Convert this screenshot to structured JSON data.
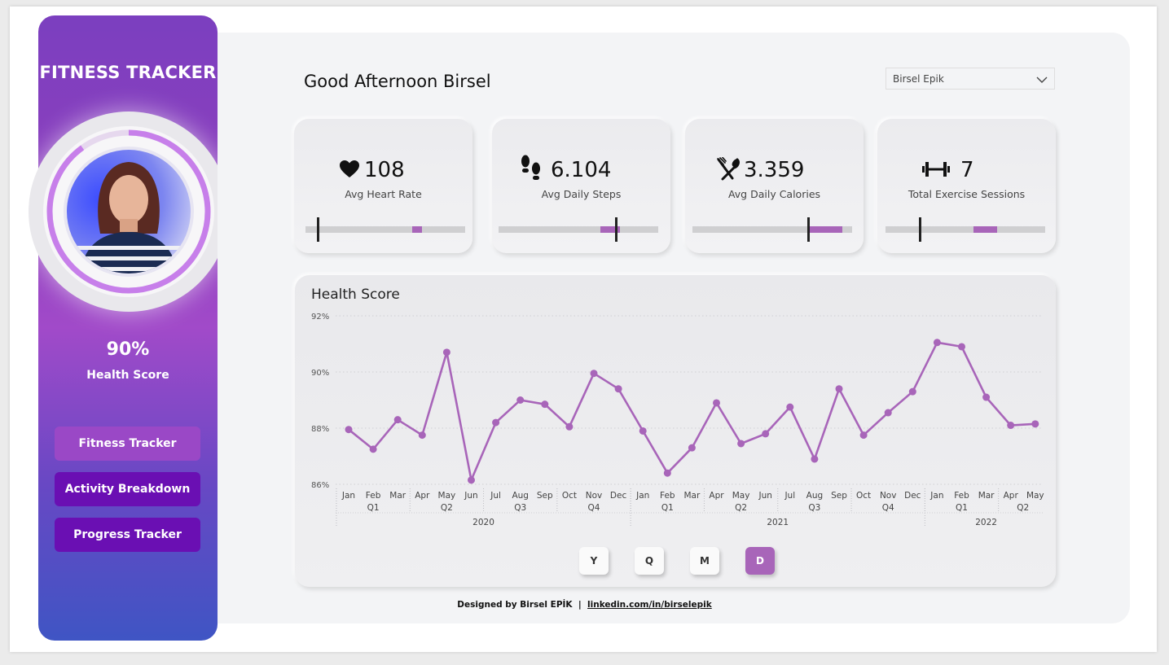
{
  "sidebar": {
    "title": "FITNESS TRACKER",
    "health_score_value": "90%",
    "health_score_fraction": 0.9,
    "health_score_label": "Health Score",
    "nav": [
      {
        "label": "Fitness Tracker",
        "active": true
      },
      {
        "label": "Activity Breakdown",
        "active": false
      },
      {
        "label": "Progress Tracker",
        "active": false
      }
    ]
  },
  "header": {
    "greeting": "Good Afternoon Birsel",
    "user_select": "Birsel Epik"
  },
  "kpis": [
    {
      "icon": "heart-icon",
      "value": "108",
      "label": "Avg Heart Rate",
      "fill_start": 0.67,
      "fill_end": 0.73,
      "marker": 0.07
    },
    {
      "icon": "footsteps-icon",
      "value": "6.104",
      "label": "Avg Daily Steps",
      "fill_start": 0.64,
      "fill_end": 0.76,
      "marker": 0.73
    },
    {
      "icon": "fork-knife-icon",
      "value": "3.359",
      "label": "Avg Daily Calories",
      "fill_start": 0.72,
      "fill_end": 0.94,
      "marker": 0.72
    },
    {
      "icon": "dumbbell-icon",
      "value": "7",
      "label": "Total Exercise Sessions",
      "fill_start": 0.55,
      "fill_end": 0.7,
      "marker": 0.21
    }
  ],
  "chart_data": {
    "type": "line",
    "title": "Health Score",
    "ylim": [
      86,
      92
    ],
    "yticks": [
      "86%",
      "88%",
      "90%",
      "92%"
    ],
    "y_tick_values": [
      86,
      88,
      90,
      92
    ],
    "grid": true,
    "categories": [
      "Jan",
      "Feb",
      "Mar",
      "Apr",
      "May",
      "Jun",
      "Jul",
      "Aug",
      "Sep",
      "Oct",
      "Nov",
      "Dec",
      "Jan",
      "Feb",
      "Mar",
      "Apr",
      "May",
      "Jun",
      "Jul",
      "Aug",
      "Sep",
      "Oct",
      "Nov",
      "Dec",
      "Jan",
      "Feb",
      "Mar",
      "Apr",
      "May"
    ],
    "quarters": [
      {
        "label": "Q1",
        "start": 0,
        "end": 2
      },
      {
        "label": "Q2",
        "start": 3,
        "end": 5
      },
      {
        "label": "Q3",
        "start": 6,
        "end": 8
      },
      {
        "label": "Q4",
        "start": 9,
        "end": 11
      },
      {
        "label": "Q1",
        "start": 12,
        "end": 14
      },
      {
        "label": "Q2",
        "start": 15,
        "end": 17
      },
      {
        "label": "Q3",
        "start": 18,
        "end": 20
      },
      {
        "label": "Q4",
        "start": 21,
        "end": 23
      },
      {
        "label": "Q1",
        "start": 24,
        "end": 26
      },
      {
        "label": "Q2",
        "start": 27,
        "end": 28
      }
    ],
    "years": [
      {
        "label": "2020",
        "start": 0,
        "end": 11
      },
      {
        "label": "2021",
        "start": 12,
        "end": 23
      },
      {
        "label": "2022",
        "start": 24,
        "end": 28
      }
    ],
    "values": [
      87.95,
      87.25,
      88.3,
      87.75,
      90.7,
      86.15,
      88.2,
      89.0,
      88.85,
      88.05,
      89.95,
      89.4,
      87.9,
      86.4,
      87.3,
      88.9,
      87.45,
      87.8,
      88.75,
      86.9,
      89.4,
      87.75,
      88.55,
      89.3,
      91.05,
      90.9,
      89.1,
      88.1,
      88.15
    ],
    "line_color": "#a865b9"
  },
  "granularity": {
    "buttons": [
      "Y",
      "Q",
      "M",
      "D"
    ],
    "active": "D"
  },
  "footer": {
    "text": "Designed by Birsel EPİK",
    "separator": "|",
    "link": "linkedin.com/in/birselepik"
  }
}
